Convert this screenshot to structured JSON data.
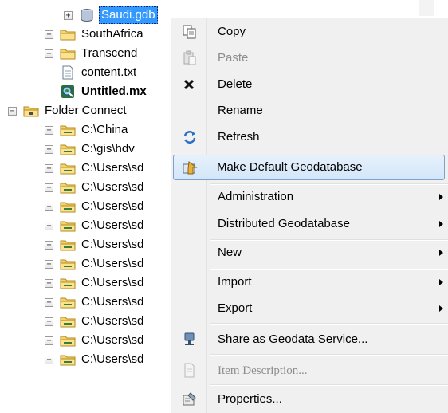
{
  "tree": {
    "items": [
      {
        "label": "Saudi.gdb",
        "state": "collapsed",
        "icon": "geodatabase-icon",
        "selected": true
      },
      {
        "label": "SouthAfrica",
        "state": "collapsed",
        "icon": "folder-icon"
      },
      {
        "label": "Transcend",
        "state": "collapsed",
        "icon": "folder-icon"
      },
      {
        "label": "content.txt",
        "state": "none",
        "icon": "text-file-icon"
      },
      {
        "label": "Untitled.mx",
        "state": "none",
        "icon": "map-document-icon",
        "bold": true
      },
      {
        "label": "Folder Connect",
        "state": "expanded",
        "icon": "folder-connections-icon"
      },
      {
        "label": "C:\\China",
        "state": "collapsed",
        "icon": "folder-connection-icon"
      },
      {
        "label": "C:\\gis\\hdv",
        "state": "collapsed",
        "icon": "folder-connection-icon"
      },
      {
        "label": "C:\\Users\\sd",
        "state": "collapsed",
        "icon": "folder-connection-icon"
      },
      {
        "label": "C:\\Users\\sd",
        "state": "collapsed",
        "icon": "folder-connection-icon"
      },
      {
        "label": "C:\\Users\\sd",
        "state": "collapsed",
        "icon": "folder-connection-icon"
      },
      {
        "label": "C:\\Users\\sd",
        "state": "collapsed",
        "icon": "folder-connection-icon"
      },
      {
        "label": "C:\\Users\\sd",
        "state": "collapsed",
        "icon": "folder-connection-icon"
      },
      {
        "label": "C:\\Users\\sd",
        "state": "collapsed",
        "icon": "folder-connection-icon"
      },
      {
        "label": "C:\\Users\\sd",
        "state": "collapsed",
        "icon": "folder-connection-icon"
      },
      {
        "label": "C:\\Users\\sd",
        "state": "collapsed",
        "icon": "folder-connection-icon"
      },
      {
        "label": "C:\\Users\\sd",
        "state": "collapsed",
        "icon": "folder-connection-icon"
      },
      {
        "label": "C:\\Users\\sd",
        "state": "collapsed",
        "icon": "folder-connection-icon"
      },
      {
        "label": "C:\\Users\\sd",
        "state": "collapsed",
        "icon": "folder-connection-icon"
      }
    ],
    "expand_glyph": "+",
    "collapse_glyph": "−"
  },
  "context_menu": {
    "items": [
      {
        "label": "Copy",
        "icon": "copy-icon",
        "enabled": true
      },
      {
        "label": "Paste",
        "icon": "paste-icon",
        "enabled": false
      },
      {
        "label": "Delete",
        "icon": "delete-icon",
        "enabled": true
      },
      {
        "label": "Rename",
        "icon": "",
        "enabled": true
      },
      {
        "label": "Refresh",
        "icon": "refresh-icon",
        "enabled": true
      },
      {
        "label": "Make Default Geodatabase",
        "icon": "make-default-geodatabase-icon",
        "enabled": true,
        "highlighted": true
      },
      {
        "label": "Administration",
        "icon": "",
        "enabled": true,
        "submenu": true
      },
      {
        "label": "Distributed Geodatabase",
        "icon": "",
        "enabled": true,
        "submenu": true
      },
      {
        "label": "New",
        "icon": "",
        "enabled": true,
        "submenu": true
      },
      {
        "label": "Import",
        "icon": "",
        "enabled": true,
        "submenu": true
      },
      {
        "label": "Export",
        "icon": "",
        "enabled": true,
        "submenu": true
      },
      {
        "label": "Share as Geodata Service...",
        "icon": "share-service-icon",
        "enabled": true
      },
      {
        "label": "Item Description...",
        "icon": "item-description-icon",
        "enabled": false
      },
      {
        "label": "Properties...",
        "icon": "properties-icon",
        "enabled": true
      }
    ]
  },
  "colors": {
    "selection": "#3399ff",
    "menu_highlight_border": "#7da2ce",
    "menu_background": "#f0f0f0",
    "disabled_text": "#8d8d8d"
  }
}
